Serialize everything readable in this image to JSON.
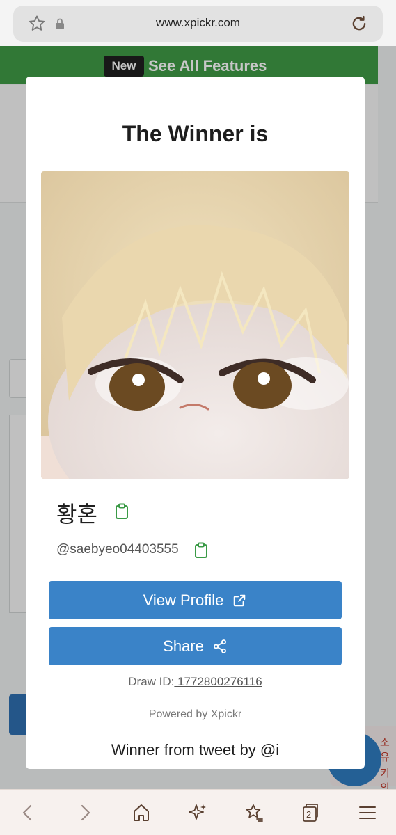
{
  "browser": {
    "url": "www.xpickr.com",
    "tab_count": "2",
    "icons": [
      "star-icon",
      "lock-icon",
      "reload-icon",
      "back-icon",
      "forward-icon",
      "home-icon",
      "sparkle-icon",
      "bookmarks-icon",
      "tabs-icon",
      "menu-icon"
    ]
  },
  "background": {
    "banner_badge": "New",
    "banner_text": "See All Features",
    "chat_text_1": "소유",
    "chat_text_2": "키의"
  },
  "modal": {
    "title": "The Winner is",
    "winner_name": "황혼",
    "winner_handle": "@saebyeo04403555",
    "view_profile_label": "View Profile",
    "share_label": "Share",
    "draw_id_label": "Draw ID:",
    "draw_id_value": " 1772800276116",
    "powered_by": "Powered by Xpickr",
    "tweet_by": "Winner from tweet by @i"
  },
  "colors": {
    "accent_button": "#3a83c8",
    "banner_green": "#3f9a46",
    "copy_icon_green": "#3a9a46"
  }
}
